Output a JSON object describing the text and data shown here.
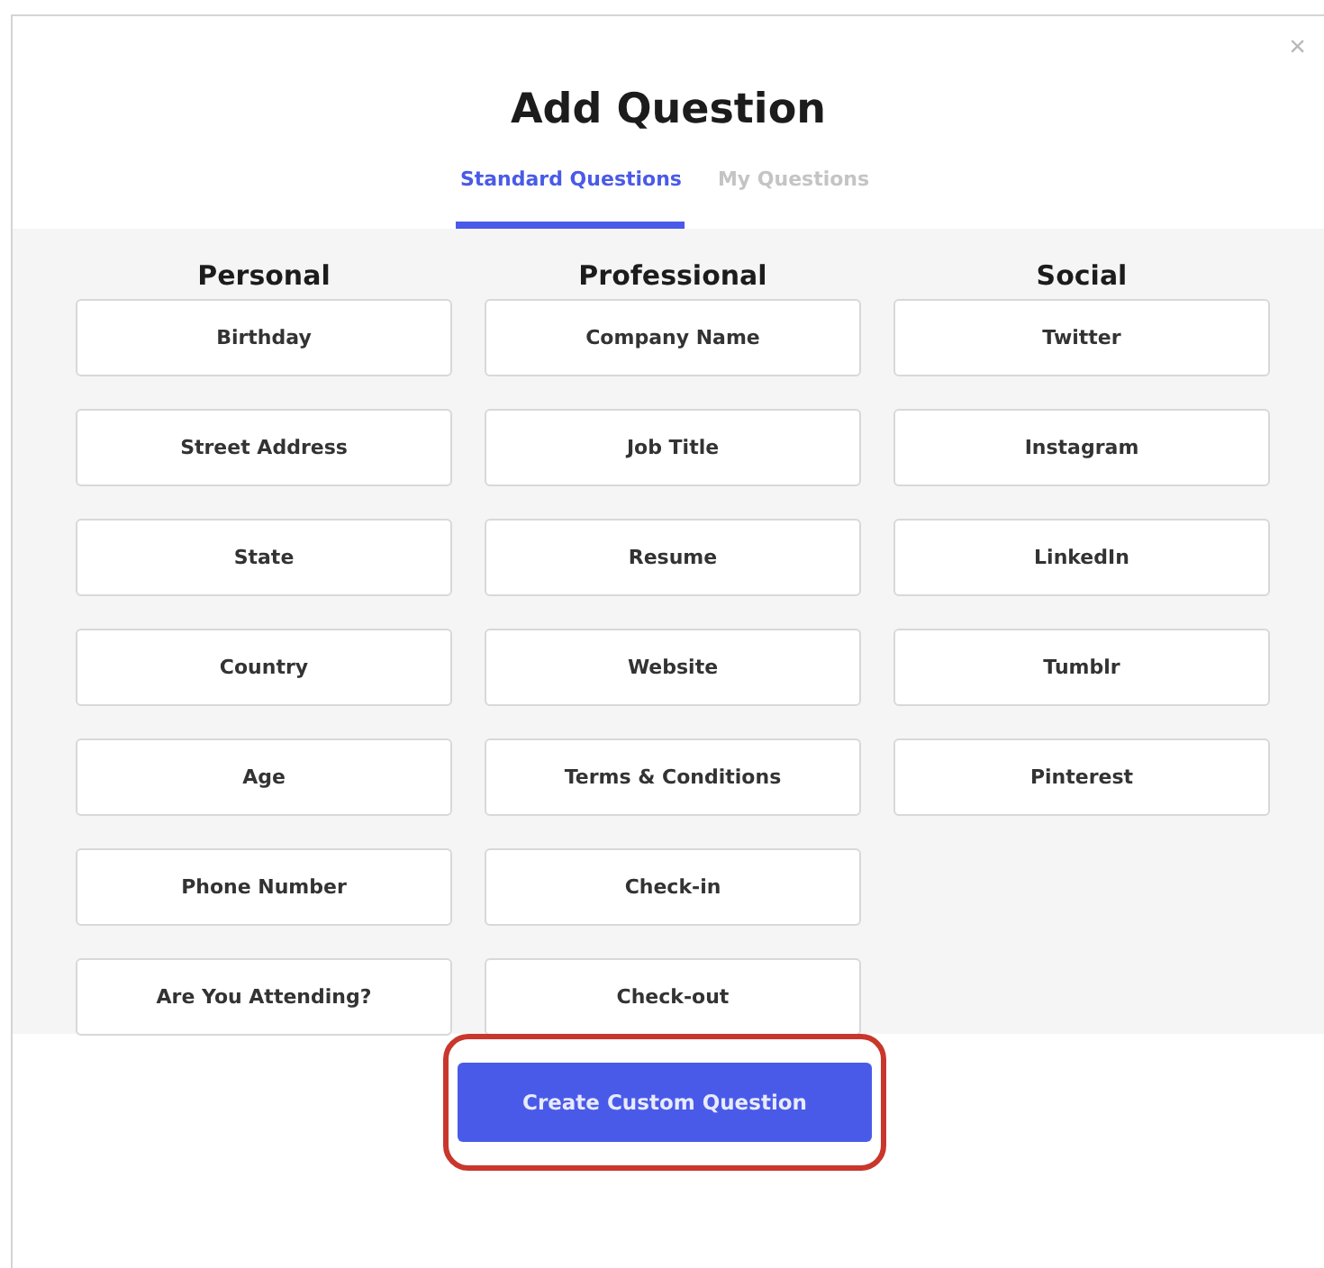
{
  "dialog": {
    "title": "Add Question",
    "close": "×"
  },
  "tabs": [
    {
      "label": "Standard Questions",
      "selected": true
    },
    {
      "label": "My Questions",
      "selected": false
    }
  ],
  "columns": [
    {
      "heading": "Personal",
      "options": [
        "Birthday",
        "Street Address",
        "State",
        "Country",
        "Age",
        "Phone Number",
        "Are You Attending?"
      ]
    },
    {
      "heading": "Professional",
      "options": [
        "Company Name",
        "Job Title",
        "Resume",
        "Website",
        "Terms & Conditions",
        "Check-in",
        "Check-out"
      ]
    },
    {
      "heading": "Social",
      "options": [
        "Twitter",
        "Instagram",
        "LinkedIn",
        "Tumblr",
        "Pinterest"
      ]
    }
  ],
  "primary_button": {
    "label": "Create Custom Question",
    "highlighted": true
  }
}
